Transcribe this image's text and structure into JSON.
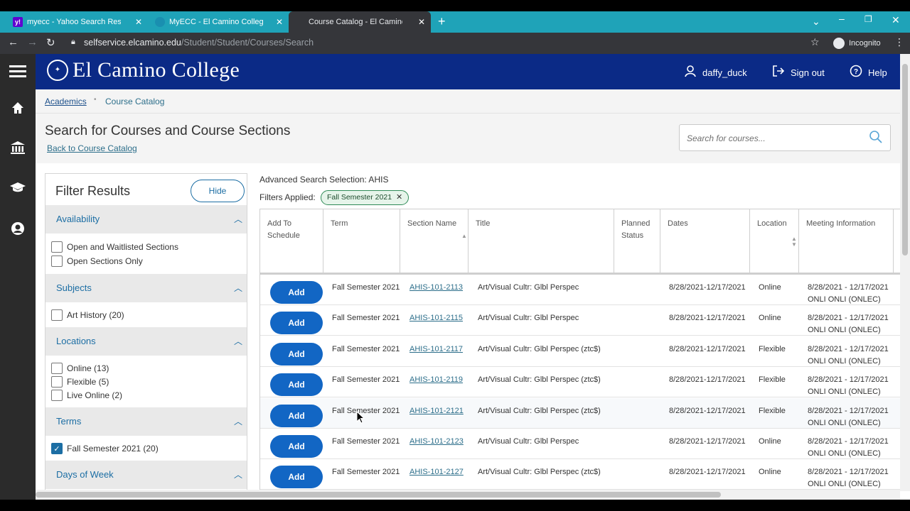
{
  "browser": {
    "tabs": [
      {
        "label": "myecc - Yahoo Search Results",
        "active": false
      },
      {
        "label": "MyECC - El Camino College Port",
        "active": false
      },
      {
        "label": "Course Catalog - El Camino Stud",
        "active": true
      }
    ],
    "url_domain": "selfservice.elcamino.edu",
    "url_path": "/Student/Student/Courses/Search",
    "profile": "Incognito"
  },
  "header": {
    "logo": "El Camino College",
    "user": "daffy_duck",
    "signout": "Sign out",
    "help": "Help"
  },
  "breadcrumb": {
    "root": "Academics",
    "current": "Course Catalog"
  },
  "page": {
    "title": "Search for Courses and Course Sections",
    "back_link": "Back to Course Catalog",
    "search_placeholder": "Search for courses..."
  },
  "filter": {
    "title": "Filter Results",
    "hide": "Hide",
    "sections": [
      {
        "label": "Availability",
        "options": [
          {
            "label": "Open and Waitlisted Sections",
            "checked": false
          },
          {
            "label": "Open Sections Only",
            "checked": false
          }
        ]
      },
      {
        "label": "Subjects",
        "options": [
          {
            "label": "Art History (20)",
            "checked": false
          }
        ]
      },
      {
        "label": "Locations",
        "options": [
          {
            "label": "Online (13)",
            "checked": false
          },
          {
            "label": "Flexible (5)",
            "checked": false
          },
          {
            "label": "Live Online (2)",
            "checked": false
          }
        ]
      },
      {
        "label": "Terms",
        "options": [
          {
            "label": "Fall Semester 2021 (20)",
            "checked": true
          }
        ]
      },
      {
        "label": "Days of Week",
        "options": []
      }
    ]
  },
  "results": {
    "advanced": "Advanced Search Selection: AHIS",
    "filters_applied": "Filters Applied:",
    "chip": "Fall Semester 2021",
    "add_label": "Add",
    "columns": [
      "Add To Schedule",
      "Term",
      "Section Name",
      "Title",
      "Planned Status",
      "Dates",
      "Location",
      "Meeting Information"
    ],
    "rows": [
      {
        "term": "Fall Semester 2021",
        "section": "AHIS-101-2113",
        "title": "Art/Visual Cultr: Glbl Perspec",
        "dates": "8/28/2021-12/17/2021",
        "location": "Online",
        "meeting1": "8/28/2021 - 12/17/2021",
        "meeting2": "ONLI ONLI (ONLEC)"
      },
      {
        "term": "Fall Semester 2021",
        "section": "AHIS-101-2115",
        "title": "Art/Visual Cultr: Glbl Perspec",
        "dates": "8/28/2021-12/17/2021",
        "location": "Online",
        "meeting1": "8/28/2021 - 12/17/2021",
        "meeting2": "ONLI ONLI (ONLEC)"
      },
      {
        "term": "Fall Semester 2021",
        "section": "AHIS-101-2117",
        "title": "Art/Visual Cultr: Glbl Perspec (ztc$)",
        "dates": "8/28/2021-12/17/2021",
        "location": "Flexible",
        "meeting1": "8/28/2021 - 12/17/2021",
        "meeting2": "ONLI ONLI (ONLEC)"
      },
      {
        "term": "Fall Semester 2021",
        "section": "AHIS-101-2119",
        "title": "Art/Visual Cultr: Glbl Perspec (ztc$)",
        "dates": "8/28/2021-12/17/2021",
        "location": "Flexible",
        "meeting1": "8/28/2021 - 12/17/2021",
        "meeting2": "ONLI ONLI (ONLEC)"
      },
      {
        "term": "Fall Semester 2021",
        "section": "AHIS-101-2121",
        "title": "Art/Visual Cultr: Glbl Perspec (ztc$)",
        "dates": "8/28/2021-12/17/2021",
        "location": "Flexible",
        "meeting1": "8/28/2021 - 12/17/2021",
        "meeting2": "ONLI ONLI (ONLEC)"
      },
      {
        "term": "Fall Semester 2021",
        "section": "AHIS-101-2123",
        "title": "Art/Visual Cultr: Glbl Perspec",
        "dates": "8/28/2021-12/17/2021",
        "location": "Online",
        "meeting1": "8/28/2021 - 12/17/2021",
        "meeting2": "ONLI ONLI (ONLEC)"
      },
      {
        "term": "Fall Semester 2021",
        "section": "AHIS-101-2127",
        "title": "Art/Visual Cultr: Glbl Perspec (ztc$)",
        "dates": "8/28/2021-12/17/2021",
        "location": "Online",
        "meeting1": "8/28/2021 - 12/17/2021",
        "meeting2": "ONLI ONLI (ONLEC)"
      }
    ]
  }
}
